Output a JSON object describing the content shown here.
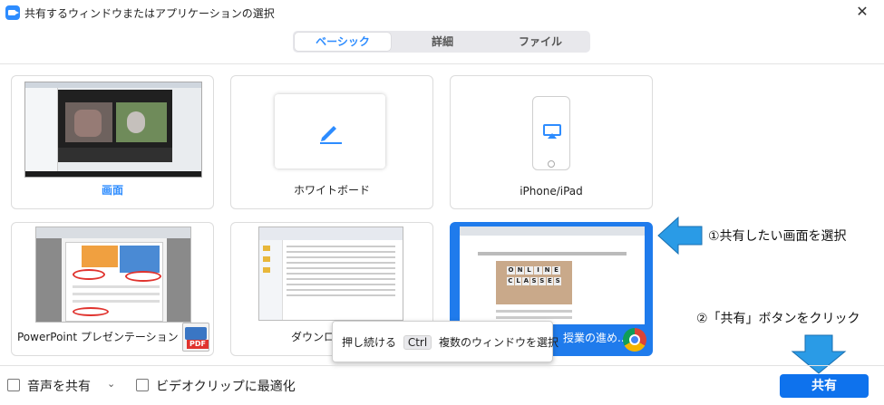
{
  "window": {
    "title": "共有するウィンドウまたはアプリケーションの選択",
    "close_glyph": "✕"
  },
  "tabs": [
    {
      "label": "ベーシック",
      "active": true
    },
    {
      "label": "詳細",
      "active": false
    },
    {
      "label": "ファイル",
      "active": false
    }
  ],
  "cards": {
    "screen": "画面",
    "whiteboard": "ホワイトボード",
    "iphone": "iPhone/iPad",
    "powerpoint": "PowerPoint プレゼンテーション - P...",
    "downloads": "ダウンロ",
    "chrome": "授業の進め..."
  },
  "thumb_text": {
    "online": [
      "O",
      "N",
      "L",
      "I",
      "N",
      "E"
    ],
    "classes": [
      "C",
      "L",
      "A",
      "S",
      "S",
      "E",
      "S"
    ],
    "pdf": "PDF"
  },
  "tooltip": {
    "prefix": "押し続ける",
    "key": "Ctrl",
    "suffix": "複数のウィンドウを選択",
    "close": "×"
  },
  "footer": {
    "audio_label": "音声を共有",
    "audio_caret": "⌄",
    "video_label": "ビデオクリップに最適化",
    "share_button": "共有"
  },
  "annotations": {
    "step1": "①共有したい画面を選択",
    "step2": "②「共有」ボタンをクリック"
  },
  "colors": {
    "accent": "#2d8cff",
    "button": "#0e72ed",
    "selected_border": "#1f7bec",
    "arrow": "#2a9be6"
  }
}
